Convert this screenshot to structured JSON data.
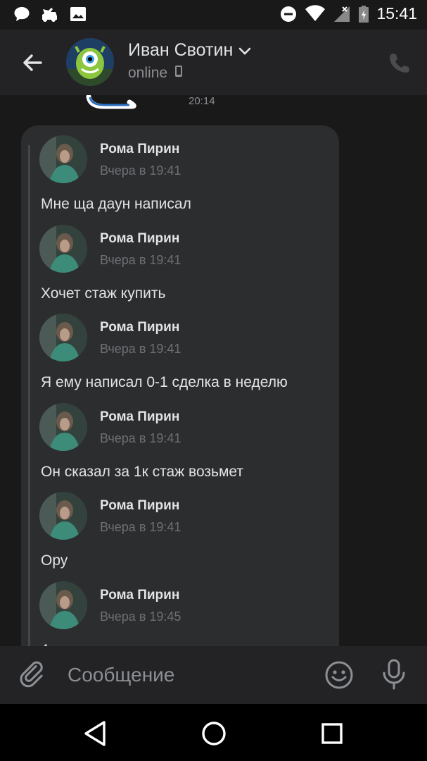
{
  "status_bar": {
    "time": "15:41",
    "left_icons": [
      "chat-bubble-icon",
      "dump-truck-icon",
      "image-icon"
    ],
    "right_icons": [
      "do-not-disturb-icon",
      "wifi-icon",
      "no-signal-icon",
      "battery-icon"
    ]
  },
  "header": {
    "contact_name": "Иван Свотин",
    "status": "online",
    "status_icon": "mobile-phone-icon",
    "call_icon": "phone-icon"
  },
  "chat": {
    "previous_message_time": "20:14",
    "forwarded": [
      {
        "author": "Рома Пирин",
        "time": "Вчера в 19:41",
        "text": "Мне ща даун написал"
      },
      {
        "author": "Рома Пирин",
        "time": "Вчера в 19:41",
        "text": "Хочет стаж купить"
      },
      {
        "author": "Рома Пирин",
        "time": "Вчера в 19:41",
        "text": "Я ему написал 0-1 сделка в неделю"
      },
      {
        "author": "Рома Пирин",
        "time": "Вчера в 19:41",
        "text": "Он сказал за 1к стаж возьмет"
      },
      {
        "author": "Рома Пирин",
        "time": "Вчера в 19:41",
        "text": "Ору"
      },
      {
        "author": "Рома Пирин",
        "time": "Вчера в 19:45",
        "text": "А"
      }
    ]
  },
  "composer": {
    "placeholder": "Сообщение",
    "value": ""
  },
  "nav": {
    "buttons": [
      "back-triangle-icon",
      "home-circle-icon",
      "recents-square-icon"
    ]
  },
  "colors": {
    "background": "#19191a",
    "header": "#232325",
    "bubble": "#2c2d2f",
    "text": "#e1e3e6",
    "muted": "#8c8f94"
  }
}
